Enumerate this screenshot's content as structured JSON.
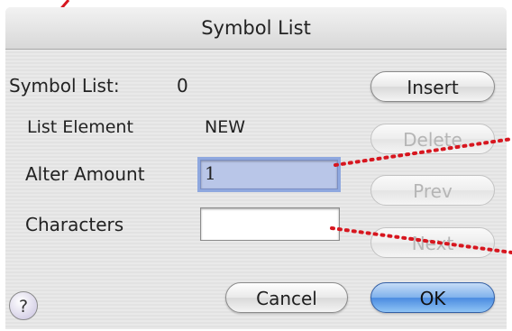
{
  "window": {
    "title": "Symbol List"
  },
  "form": {
    "symbol_list_label": "Symbol List:",
    "symbol_list_value": "0",
    "list_element_label": "List Element",
    "list_element_value": "NEW",
    "alter_amount_label": "Alter Amount",
    "alter_amount_value": "1",
    "characters_label": "Characters",
    "characters_value": ""
  },
  "buttons": {
    "insert": "Insert",
    "delete": "Delete",
    "prev": "Prev",
    "next": "Next",
    "cancel": "Cancel",
    "ok": "OK",
    "help": "?"
  },
  "colors": {
    "annotation": "#d7161f",
    "accent": "#4a8be0",
    "focus": "#8fa8df"
  }
}
